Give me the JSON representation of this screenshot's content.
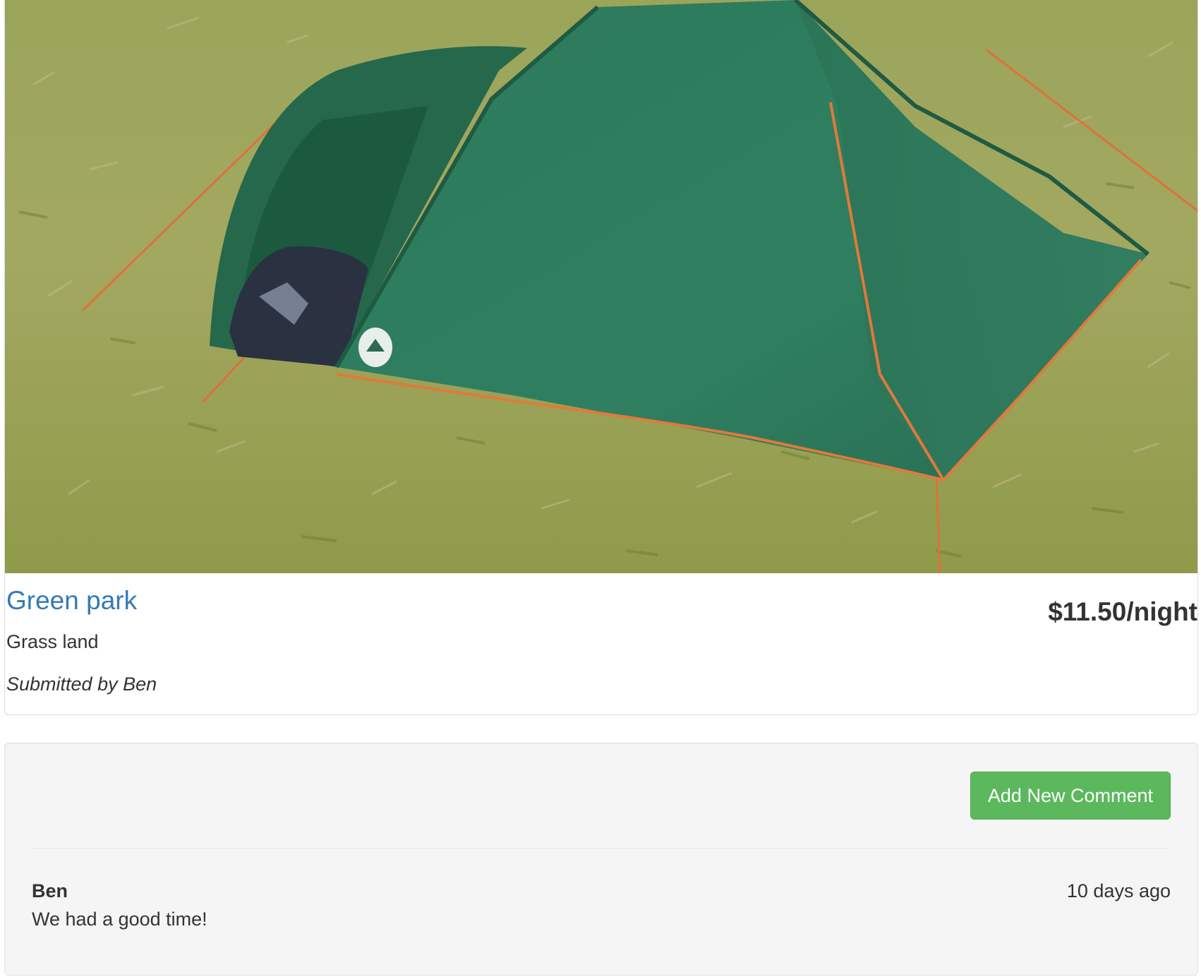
{
  "campground": {
    "name": "Green park",
    "price": "$11.50/night",
    "description": "Grass land",
    "submitted_by": "Submitted by Ben",
    "image_subject": "green-dome-tent-on-grass"
  },
  "comments_section": {
    "add_button_label": "Add New Comment",
    "comments": [
      {
        "author": "Ben",
        "time": "10 days ago",
        "text": "We had a good time!"
      }
    ]
  },
  "colors": {
    "link": "#337ab7",
    "success": "#5cb85c",
    "well_bg": "#f5f5f5",
    "text": "#333333"
  }
}
